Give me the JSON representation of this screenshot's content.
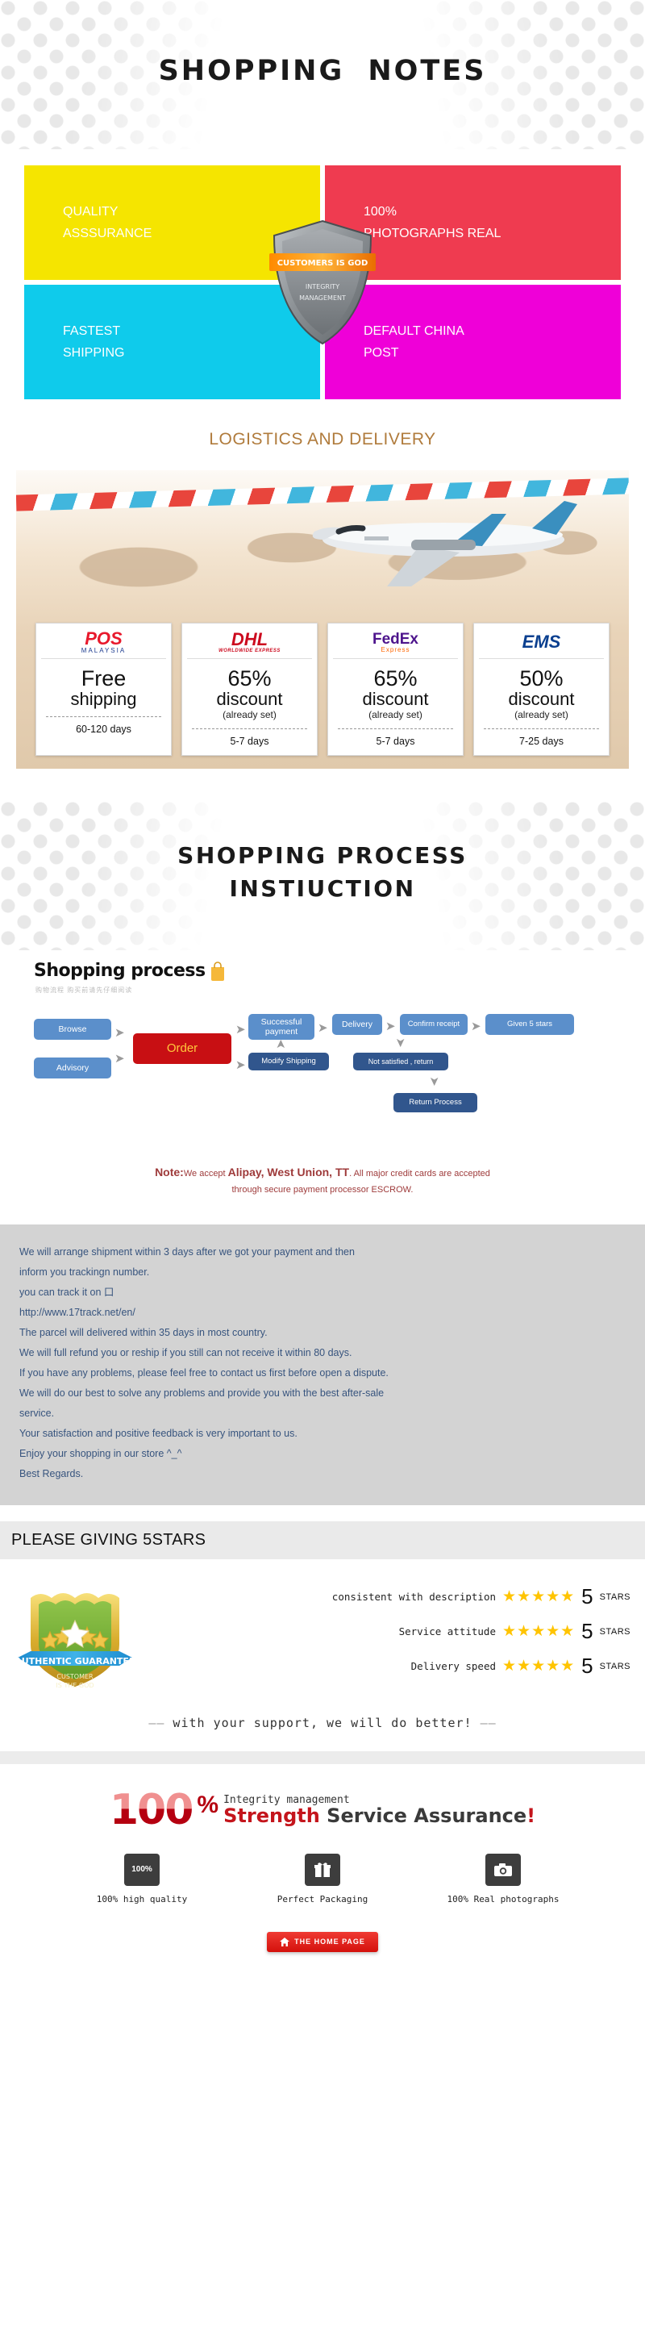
{
  "hero": {
    "title": "SHOPPING   NOTES"
  },
  "quad": {
    "cells": [
      {
        "text": "QUALITY\nASSSURANCE",
        "color": "#f5e500"
      },
      {
        "text": "100%\nPHOTOGRAPHS REAL",
        "color": "#ef3b50"
      },
      {
        "text": "FASTEST\nSHIPPING",
        "color": "#0fcbeb"
      },
      {
        "text": "DEFAULT CHINA\nPOST",
        "color": "#ef00d8"
      }
    ],
    "shield": {
      "line1": "CUSTOMERS  IS  GOD",
      "line2": "INTEGRITY",
      "line3": "MANAGEMENT"
    }
  },
  "logistics": {
    "title": "LOGISTICS AND DELIVERY",
    "carriers": [
      {
        "logo": "POS",
        "logo_sub": "MALAYSIA",
        "main": "Free",
        "sub": "shipping",
        "note": "",
        "days": "60-120 days"
      },
      {
        "logo": "DHL",
        "logo_sub": "WORLDWIDE EXPRESS",
        "main": "65%",
        "sub": "discount",
        "note": "(already set)",
        "days": "5-7 days"
      },
      {
        "logo": "FedEx",
        "logo_sub": "Express",
        "main": "65%",
        "sub": "discount",
        "note": "(already set)",
        "days": "5-7 days"
      },
      {
        "logo": "EMS",
        "logo_sub": "",
        "main": "50%",
        "sub": "discount",
        "note": "(already set)",
        "days": "7-25 days"
      }
    ]
  },
  "process": {
    "title_line1": "SHOPPING  PROCESS",
    "title_line2": "INSTIUCTION",
    "flow_heading": "Shopping process",
    "flow_subheading": "购物流程 购买前请先仔细阅读",
    "nodes": {
      "browse": "Browse",
      "advisory": "Advisory",
      "order": "Order",
      "successful_payment": "Successful\npayment",
      "modify_shipping": "Modify Shipping",
      "delivery": "Delivery",
      "not_satisfied": "Not satisfied , return",
      "confirm_receipt": "Confirm receipt",
      "return_process": "Return Process",
      "given_5_stars": "Given 5 stars"
    },
    "note_prefix": "Note:",
    "note_small1": "We accept ",
    "note_strong": "Alipay, West Union, TT",
    "note_small2": ". All major credit cards are accepted",
    "note_line2": "through secure payment processor ESCROW."
  },
  "info": {
    "lines": [
      "We will arrange shipment within 3 days after we got your payment and then",
      "inform you trackingn number.",
      "you can track it on 口",
      "http://www.17track.net/en/",
      "The parcel will delivered within 35 days in most country.",
      "We will full refund you or reship if you still can not receive it within 80 days.",
      "If you have any problems, please feel free to contact us first before open a dispute.",
      "We will do our best to solve any problems and provide you with the best after-sale",
      "service.",
      "Your satisfaction and positive feedback is very important to us.",
      "Enjoy your shopping in our store ^_^",
      "Best Regards."
    ]
  },
  "stars": {
    "section_title": "PLEASE GIVING 5STARS",
    "badge_banner": "AUTHENTIC GUARANTEE",
    "badge_line1": "CUSTOMER",
    "badge_line2": "IS THE GOD",
    "rows": [
      {
        "label": "consistent with description",
        "stars": "★★★★★",
        "num": "5",
        "word": "STARS"
      },
      {
        "label": "Service attitude",
        "stars": "★★★★★",
        "num": "5",
        "word": "STARS"
      },
      {
        "label": "Delivery speed",
        "stars": "★★★★★",
        "num": "5",
        "word": "STARS"
      }
    ],
    "support_line": "with your support, we will do better!"
  },
  "footer": {
    "hundred": "100",
    "percent": "%",
    "tagline_top": "Integrity management",
    "tagline_strength": "Strength ",
    "tagline_service": "Service Assurance",
    "tagline_excl": "!",
    "features": [
      {
        "icon": "quality-badge-icon",
        "glyph": "100%",
        "label": "100% high quality"
      },
      {
        "icon": "gift-box-icon",
        "glyph": "Ἰ1",
        "label": "Perfect Packaging"
      },
      {
        "icon": "camera-icon",
        "glyph": "◎",
        "label": "100% Real photographs"
      }
    ],
    "home_button": "THE HOME PAGE"
  }
}
